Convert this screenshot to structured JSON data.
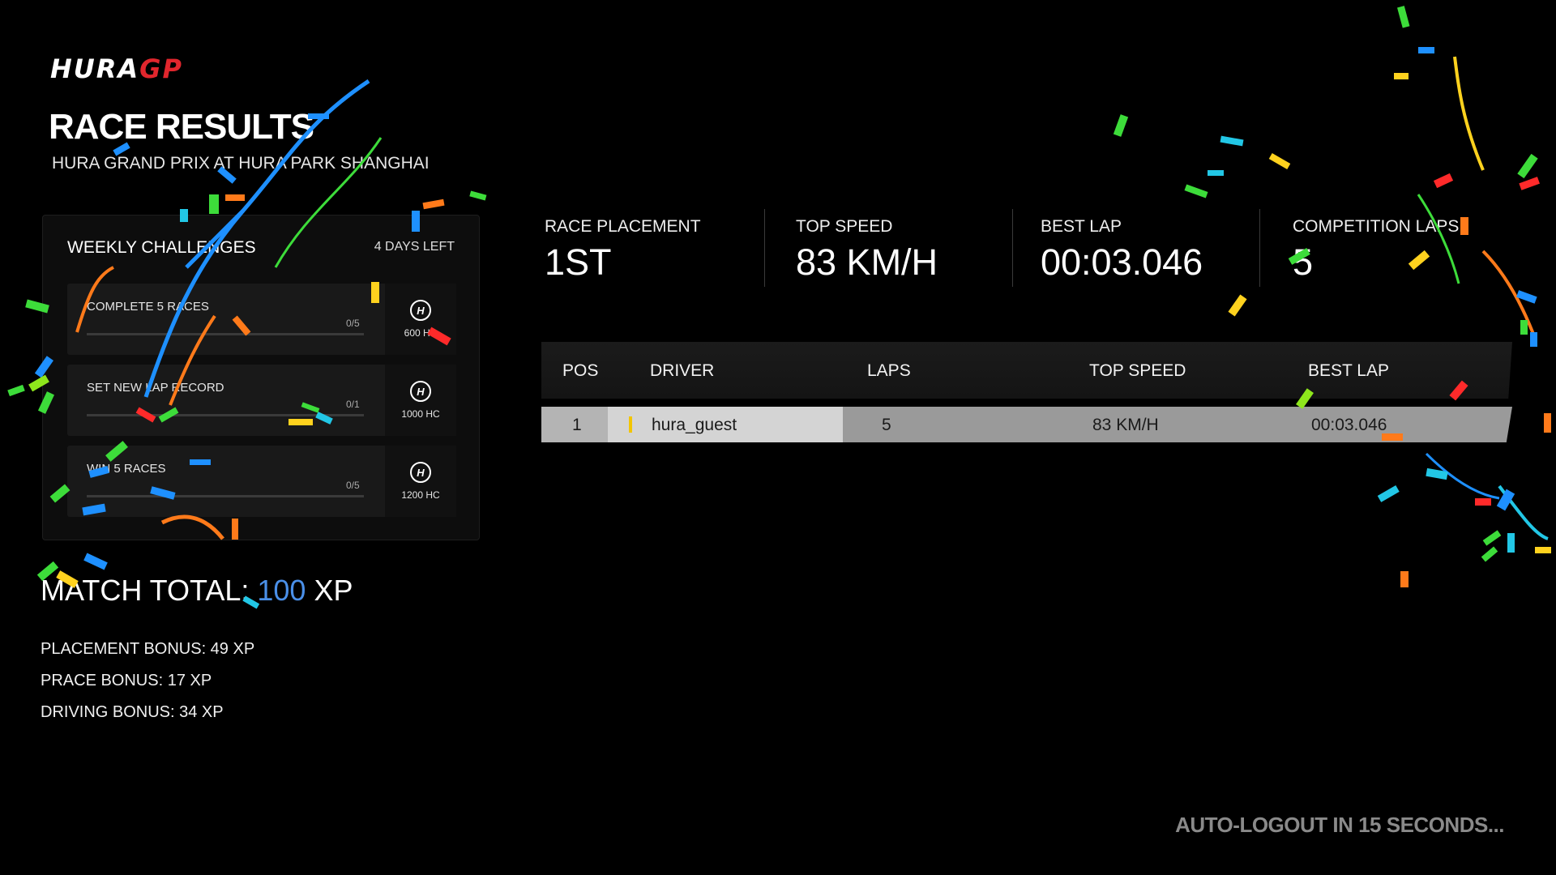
{
  "brand": {
    "part1": "HURA",
    "part2": "GP"
  },
  "header": {
    "title": "RACE RESULTS",
    "subtitle": "HURA GRAND PRIX AT HURA PARK SHANGHAI"
  },
  "weekly_challenges": {
    "title": "WEEKLY CHALLENGES",
    "time_left": "4 DAYS LEFT",
    "items": [
      {
        "name": "COMPLETE 5 RACES",
        "progress": "0/5",
        "progress_fraction": 0,
        "reward": "600 HC",
        "icon": "hura-coin-icon"
      },
      {
        "name": "SET NEW LAP RECORD",
        "progress": "0/1",
        "progress_fraction": 0,
        "reward": "1000 HC",
        "icon": "hura-coin-icon"
      },
      {
        "name": "WIN 5 RACES",
        "progress": "0/5",
        "progress_fraction": 0,
        "reward": "1200 HC",
        "icon": "hura-coin-icon"
      }
    ]
  },
  "match_total": {
    "label": "MATCH TOTAL:",
    "value": "100",
    "unit": "XP"
  },
  "bonuses": [
    "PLACEMENT BONUS: 49 XP",
    "PRACE BONUS: 17 XP",
    "DRIVING BONUS: 34 XP"
  ],
  "stats": [
    {
      "label": "RACE PLACEMENT",
      "value": "1ST"
    },
    {
      "label": "TOP SPEED",
      "value": "83 KM/H"
    },
    {
      "label": "BEST LAP",
      "value": "00:03.046"
    },
    {
      "label": "COMPETITION LAPS",
      "value": "5"
    }
  ],
  "results_table": {
    "columns": [
      "POS",
      "DRIVER",
      "LAPS",
      "TOP SPEED",
      "BEST LAP"
    ],
    "rows": [
      {
        "pos": "1",
        "driver": "hura_guest",
        "laps": "5",
        "top_speed": "83 KM/H",
        "best_lap": "00:03.046"
      }
    ]
  },
  "footer": {
    "logout_text": "AUTO-LOGOUT IN 15 SECONDS..."
  },
  "colors": {
    "brand_red": "#e1262d",
    "xp_blue": "#4a8fe8",
    "driver_marker": "#f2c500",
    "confetti": [
      "#1e90ff",
      "#22c7e6",
      "#3ddc3a",
      "#ff7a1a",
      "#ffd21e",
      "#ff2a2a",
      "#8ee61c"
    ]
  }
}
